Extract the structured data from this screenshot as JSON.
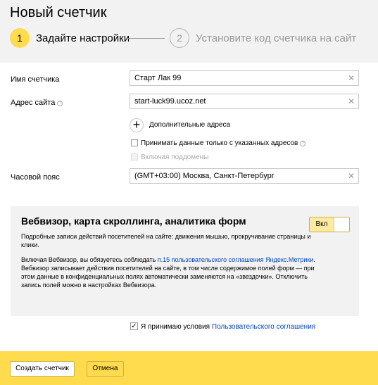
{
  "header": {
    "title": "Новый счетчик",
    "steps": [
      {
        "number": "1",
        "label": "Задайте настройки"
      },
      {
        "number": "2",
        "label": "Установите код счетчика на сайт"
      }
    ]
  },
  "form": {
    "counter_name": {
      "label": "Имя счетчика",
      "value": "Старт Лак 99"
    },
    "site_address": {
      "label": "Адрес сайта",
      "value": "start-luck99.ucoz.net"
    },
    "additional_addresses": "Дополнительные адреса",
    "accept_only_listed": "Принимать данные только с указанных адресов",
    "include_subdomains": "Включая поддомены",
    "timezone": {
      "label": "Часовой пояс",
      "value": "(GMT+03:00) Москва, Санкт-Петербург"
    }
  },
  "webvisor": {
    "title": "Вебвизор, карта скроллинга, аналитика форм",
    "desc1": "Подробные записи действий посетителей на сайте: движения мышью, прокручивание страницы и клики.",
    "desc2_prefix": "Включая Вебвизор, вы обязуетесь соблюдать ",
    "desc2_link": "п.15 пользовательского соглашения Яндекс.Метрики",
    "desc2_suffix": ". Вебвизор записывает действия посетителей на сайте, в том числе содержимое полей форм — при этом данные в конфиденциальных полях автоматически заменяются на «звездочки». Отключить запись полей можно в настройках Вебвизора.",
    "toggle_label": "Вкл"
  },
  "agreement": {
    "prefix": "Я принимаю условия ",
    "link": "Пользовательского соглашения"
  },
  "footer": {
    "create_button": "Создать счетчик",
    "cancel_button": "Отмена"
  },
  "colors": {
    "accent": "#ffdb4d",
    "link": "#0044bb",
    "panel": "#f2f2f2"
  }
}
